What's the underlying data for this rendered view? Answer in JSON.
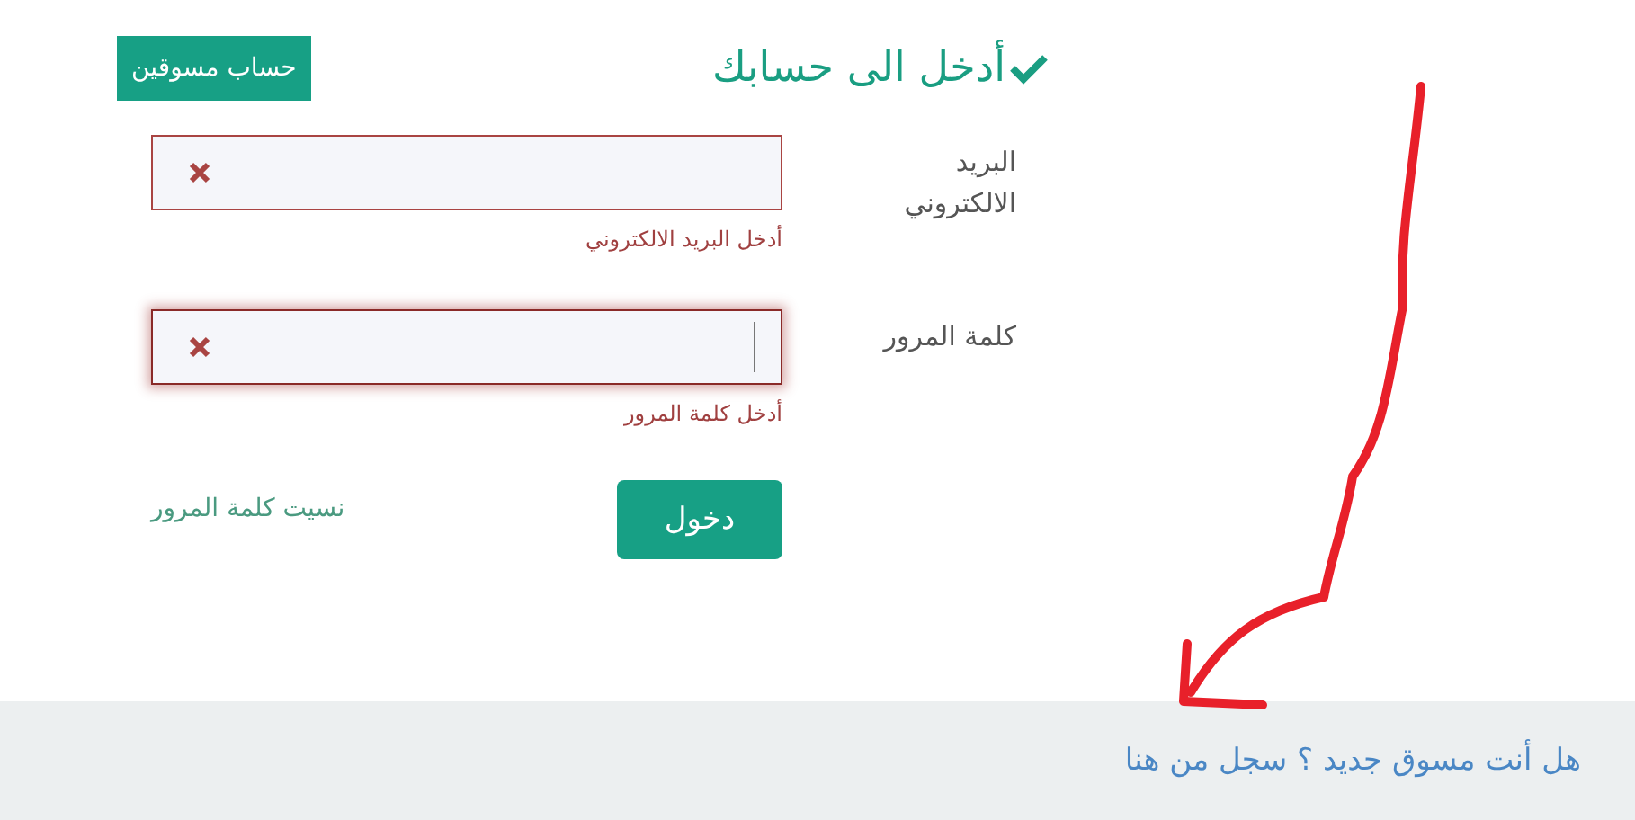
{
  "header": {
    "title": "أدخل الى حسابك",
    "account_button": "حساب مسوقين"
  },
  "fields": [
    {
      "label": "البريد الالكتروني",
      "invalid": true,
      "focused": false,
      "error": "أدخل البريد الالكتروني"
    },
    {
      "label": "كلمة المرور",
      "invalid": true,
      "focused": true,
      "error": "أدخل كلمة المرور"
    }
  ],
  "login_button": "دخول",
  "forgot_link": "نسيت كلمة المرور",
  "footer": {
    "register_link": "هل أنت مسوق جديد ؟ سجل من هنا"
  }
}
